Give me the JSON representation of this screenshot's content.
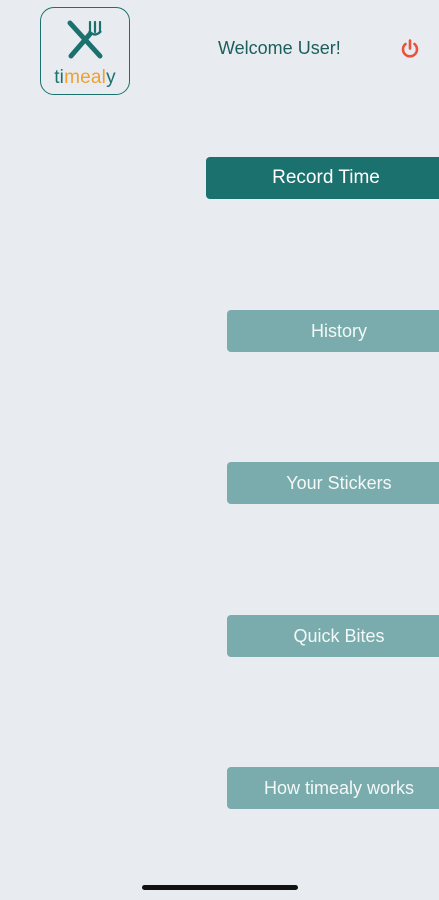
{
  "app": {
    "logo_parts": [
      "ti",
      "meal",
      "y"
    ],
    "brand_colors": {
      "primary": "#1b716e",
      "secondary": "#7aacad",
      "accent": "#f0a030",
      "power": "#e8533a",
      "background": "#e8ecf0"
    }
  },
  "header": {
    "welcome_text": "Welcome User!",
    "power_icon": "power-icon"
  },
  "menu": {
    "record_time": "Record Time",
    "history": "History",
    "stickers": "Your Stickers",
    "quick_bites": "Quick Bites",
    "how_it_works": "How timealy works"
  }
}
